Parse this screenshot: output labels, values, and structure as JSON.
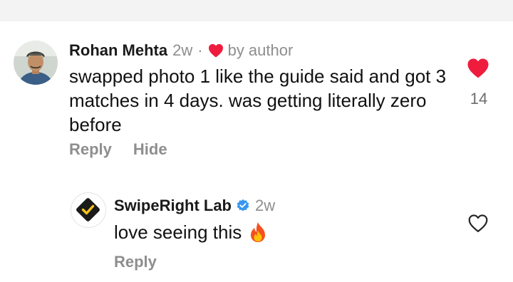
{
  "comments": [
    {
      "author": "Rohan Mehta",
      "time": "2w",
      "separator": "·",
      "liked_by_author_text": "by author",
      "text": "swapped photo 1 like the guide said and got 3 matches in 4 days. was getting literally zero before",
      "actions": [
        "Reply",
        "Hide"
      ],
      "like_count": "14",
      "liked": true
    }
  ],
  "replies": [
    {
      "author": "SwipeRight Lab",
      "verified": true,
      "time": "2w",
      "text": "love seeing this",
      "emoji": "fire-emoji",
      "actions": [
        "Reply"
      ],
      "liked": false
    }
  ],
  "colors": {
    "like_red": "#ee1d3e",
    "verified_blue": "#3897f0",
    "muted_gray": "#8e8e8e",
    "brand_yellow": "#f6c318"
  },
  "icons": [
    "heart-filled-icon",
    "heart-outline-icon",
    "verified-badge-icon",
    "checkmark-logo-icon"
  ]
}
